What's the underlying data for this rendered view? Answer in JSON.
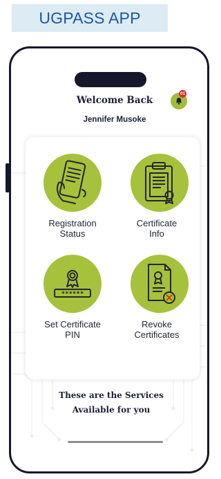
{
  "banner": {
    "title": "UGPASS APP"
  },
  "header": {
    "welcome": "Welcome Back",
    "user_name": "Jennifer Musoke",
    "notification_count": "01",
    "notification_icon": "bell-icon"
  },
  "services": [
    {
      "label": "Registration\nStatus",
      "icon": "phone-document-icon"
    },
    {
      "label": "Certificate\nInfo",
      "icon": "clipboard-certificate-icon"
    },
    {
      "label": "Set Certificate\nPIN",
      "icon": "certificate-pin-icon"
    },
    {
      "label": "Revoke\nCertificates",
      "icon": "revoke-certificate-icon"
    }
  ],
  "footer": {
    "text": "These are the Services\nAvailable for you"
  },
  "colors": {
    "accent_green": "#a6c13b",
    "phone_frame": "#15172b",
    "banner_bg": "#dcebf4",
    "banner_text": "#1c58a6",
    "badge_red": "#e02929"
  }
}
